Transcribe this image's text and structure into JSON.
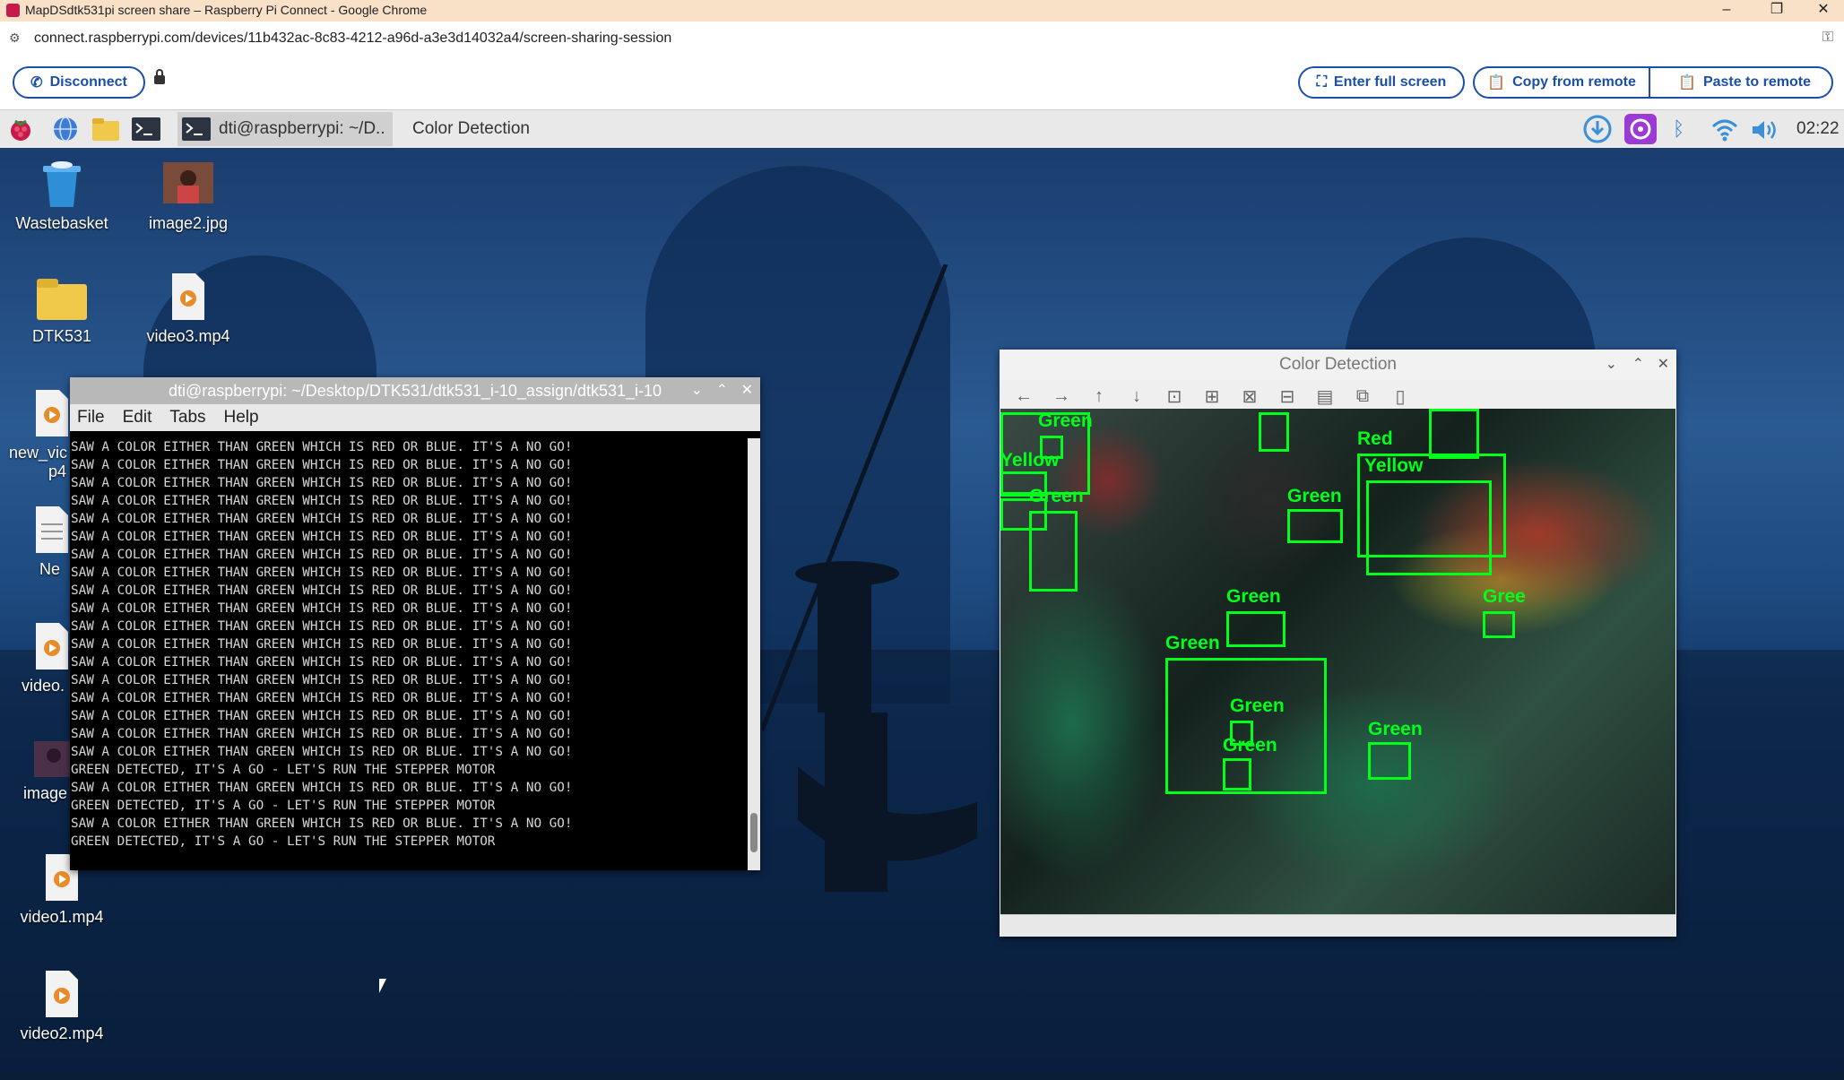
{
  "browser": {
    "title": "MapDSdtk531pi screen share – Raspberry Pi Connect - Google Chrome",
    "url": "connect.raspberrypi.com/devices/11b432ac-8c83-4212-a96d-a3e3d14032a4/screen-sharing-session"
  },
  "connect_toolbar": {
    "disconnect_label": "Disconnect",
    "fullscreen_label": "Enter full screen",
    "copy_label": "Copy from remote",
    "paste_label": "Paste to remote"
  },
  "taskbar": {
    "terminal_task": "dti@raspberrypi: ~/D..",
    "viewer_task": "Color Detection",
    "clock": "02:22"
  },
  "desktop_icons": {
    "wastebasket": "Wastebasket",
    "image2": "image2.jpg",
    "dtk531": "DTK531",
    "video3": "video3.mp4",
    "new_video": "new_vic",
    "new_video_2": "p4",
    "new_doc": "Ne",
    "video_partial": "video.",
    "image_partial": "image",
    "video1": "video1.mp4",
    "video2": "video2.mp4"
  },
  "terminal": {
    "title": "dti@raspberrypi: ~/Desktop/DTK531/dtk531_i-10_assign/dtk531_i-10",
    "menu": [
      "File",
      "Edit",
      "Tabs",
      "Help"
    ],
    "lines": [
      "SAW A COLOR EITHER THAN GREEN WHICH IS RED OR BLUE. IT'S A NO GO!",
      "SAW A COLOR EITHER THAN GREEN WHICH IS RED OR BLUE. IT'S A NO GO!",
      "SAW A COLOR EITHER THAN GREEN WHICH IS RED OR BLUE. IT'S A NO GO!",
      "SAW A COLOR EITHER THAN GREEN WHICH IS RED OR BLUE. IT'S A NO GO!",
      "SAW A COLOR EITHER THAN GREEN WHICH IS RED OR BLUE. IT'S A NO GO!",
      "SAW A COLOR EITHER THAN GREEN WHICH IS RED OR BLUE. IT'S A NO GO!",
      "SAW A COLOR EITHER THAN GREEN WHICH IS RED OR BLUE. IT'S A NO GO!",
      "SAW A COLOR EITHER THAN GREEN WHICH IS RED OR BLUE. IT'S A NO GO!",
      "SAW A COLOR EITHER THAN GREEN WHICH IS RED OR BLUE. IT'S A NO GO!",
      "SAW A COLOR EITHER THAN GREEN WHICH IS RED OR BLUE. IT'S A NO GO!",
      "SAW A COLOR EITHER THAN GREEN WHICH IS RED OR BLUE. IT'S A NO GO!",
      "SAW A COLOR EITHER THAN GREEN WHICH IS RED OR BLUE. IT'S A NO GO!",
      "SAW A COLOR EITHER THAN GREEN WHICH IS RED OR BLUE. IT'S A NO GO!",
      "SAW A COLOR EITHER THAN GREEN WHICH IS RED OR BLUE. IT'S A NO GO!",
      "SAW A COLOR EITHER THAN GREEN WHICH IS RED OR BLUE. IT'S A NO GO!",
      "SAW A COLOR EITHER THAN GREEN WHICH IS RED OR BLUE. IT'S A NO GO!",
      "SAW A COLOR EITHER THAN GREEN WHICH IS RED OR BLUE. IT'S A NO GO!",
      "SAW A COLOR EITHER THAN GREEN WHICH IS RED OR BLUE. IT'S A NO GO!",
      "GREEN DETECTED, IT'S A GO - LET'S RUN THE STEPPER MOTOR",
      "SAW A COLOR EITHER THAN GREEN WHICH IS RED OR BLUE. IT'S A NO GO!",
      "GREEN DETECTED, IT'S A GO - LET'S RUN THE STEPPER MOTOR",
      "SAW A COLOR EITHER THAN GREEN WHICH IS RED OR BLUE. IT'S A NO GO!",
      "GREEN DETECTED, IT'S A GO - LET'S RUN THE STEPPER MOTOR"
    ]
  },
  "viewer": {
    "title": "Color Detection",
    "labels": [
      "Green",
      "Yellow",
      "Green",
      "Red",
      "Yellow",
      "Green",
      "Green",
      "Gree",
      "Green",
      "Green",
      "Green",
      "Green"
    ]
  },
  "colors": {
    "accent": "#1c4fa8",
    "detection_box": "#00ff1a",
    "titlebar": "#f9e1c8"
  }
}
